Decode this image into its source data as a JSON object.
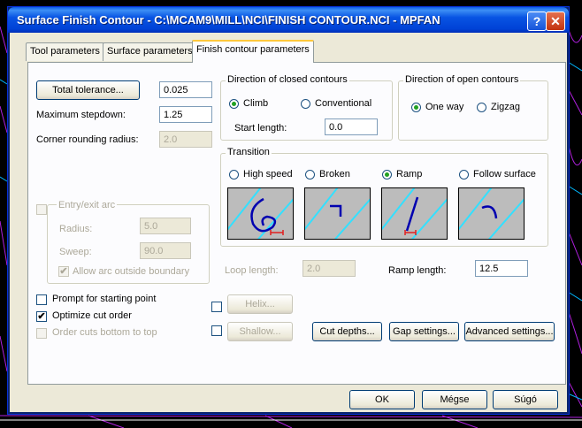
{
  "window": {
    "title": "Surface Finish Contour - C:\\MCAM9\\MILL\\NCI\\FINISH CONTOUR.NCI - MPFAN",
    "help_icon": "?",
    "close_icon": "✕"
  },
  "tabs": [
    {
      "label": "Tool parameters"
    },
    {
      "label": "Surface parameters"
    },
    {
      "label": "Finish contour parameters"
    }
  ],
  "left": {
    "total_tolerance_button": "Total tolerance...",
    "total_tolerance_value": "0.025",
    "max_stepdown_label": "Maximum stepdown:",
    "max_stepdown_value": "1.25",
    "corner_radius_label": "Corner rounding radius:",
    "corner_radius_value": "2.0"
  },
  "closed_contours": {
    "title": "Direction of closed contours",
    "climb": "Climb",
    "conventional": "Conventional",
    "start_length_label": "Start length:",
    "start_length_value": "0.0"
  },
  "open_contours": {
    "title": "Direction of open contours",
    "one_way": "One way",
    "zigzag": "Zigzag"
  },
  "transition": {
    "title": "Transition",
    "options": [
      "High speed",
      "Broken",
      "Ramp",
      "Follow surface"
    ],
    "selected": "Ramp"
  },
  "entry_exit": {
    "title": "Entry/exit arc",
    "radius_label": "Radius:",
    "radius_value": "5.0",
    "sweep_label": "Sweep:",
    "sweep_value": "90.0",
    "allow_arc_label": "Allow arc outside boundary"
  },
  "loop_length_label": "Loop length:",
  "loop_length_value": "2.0",
  "ramp_length_label": "Ramp length:",
  "ramp_length_value": "12.5",
  "options": {
    "prompt_start": "Prompt for starting point",
    "optimize_cut": "Optimize cut order",
    "order_cuts": "Order cuts bottom to top"
  },
  "buttons": {
    "helix": "Helix...",
    "shallow": "Shallow...",
    "cut_depths": "Cut depths...",
    "gap_settings": "Gap settings...",
    "advanced_settings": "Advanced settings...",
    "ok": "OK",
    "cancel": "Mégse",
    "help": "Súgó"
  },
  "colors": {
    "title_blue": "#0054e3",
    "dialog_bg": "#ece9d8",
    "cad_magenta": "#c040ff",
    "cad_cyan": "#00c8ff"
  }
}
